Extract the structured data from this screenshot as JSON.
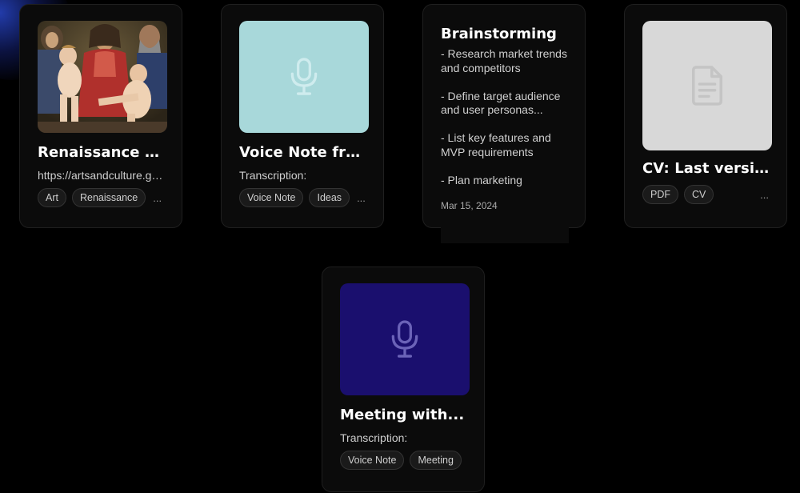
{
  "cards": [
    {
      "title": "Renaissance Art",
      "subtitle": "https://artsandculture.google.com",
      "tags": [
        "Art",
        "Renaissance"
      ],
      "more": "..."
    },
    {
      "title": "Voice Note from...",
      "subtitle": "Transcription:",
      "tags": [
        "Voice Note",
        "Ideas"
      ],
      "more": "...",
      "thumb_color": "#a8d8da",
      "icon": "microphone-icon"
    },
    {
      "title": "Brainstorming",
      "body": "- Research market trends and competitors\n\n- Define target audience and user personas...\n\n- List key features and MVP requirements\n\n- Plan marketing",
      "date": "Mar 15, 2024"
    },
    {
      "title": "CV: Last version",
      "tags": [
        "PDF",
        "CV"
      ],
      "more": "...",
      "thumb_color": "#d8d8d8",
      "icon": "document-icon"
    },
    {
      "title": "Meeting with...",
      "subtitle": "Transcription:",
      "tags": [
        "Voice Note",
        "Meeting"
      ],
      "more": "...",
      "thumb_color": "#1a0f6e",
      "icon": "microphone-icon"
    }
  ],
  "colors": {
    "background": "#000000",
    "card": "#0b0b0b",
    "voice_thumb": "#a8d8da",
    "pdf_thumb": "#d8d8d8",
    "meeting_thumb": "#1a0f6e"
  }
}
